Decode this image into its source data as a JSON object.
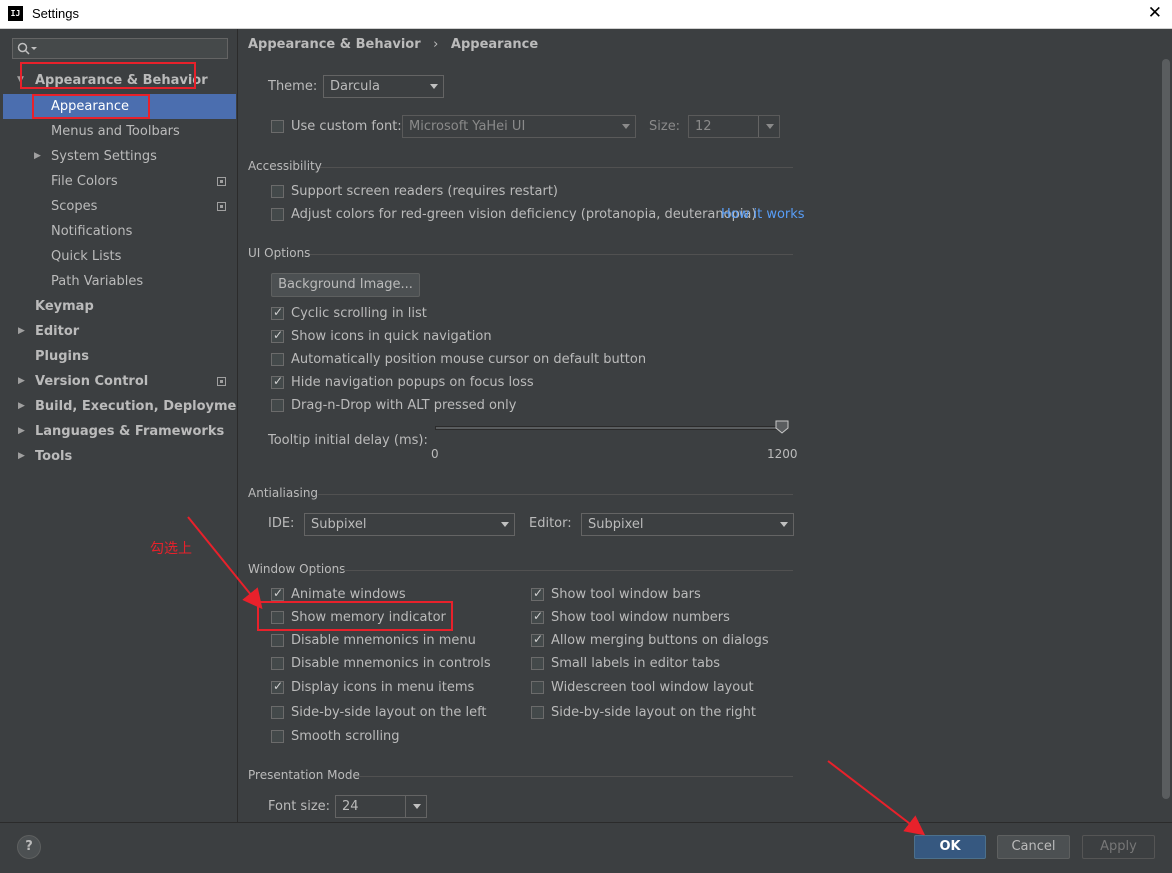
{
  "window": {
    "title": "Settings",
    "app_icon": "IJ",
    "close": "✕"
  },
  "sidebar": {
    "search": {
      "placeholder": ""
    },
    "items": [
      {
        "label": "Appearance & Behavior",
        "arrow": "▼"
      },
      {
        "label": "Appearance"
      },
      {
        "label": "Menus and Toolbars"
      },
      {
        "label": "System Settings",
        "arrow": "▶"
      },
      {
        "label": "File Colors"
      },
      {
        "label": "Scopes"
      },
      {
        "label": "Notifications"
      },
      {
        "label": "Quick Lists"
      },
      {
        "label": "Path Variables"
      },
      {
        "label": "Keymap"
      },
      {
        "label": "Editor",
        "arrow": "▶"
      },
      {
        "label": "Plugins"
      },
      {
        "label": "Version Control",
        "arrow": "▶"
      },
      {
        "label": "Build, Execution, Deployment",
        "arrow": "▶"
      },
      {
        "label": "Languages & Frameworks",
        "arrow": "▶"
      },
      {
        "label": "Tools",
        "arrow": "▶"
      }
    ]
  },
  "breadcrumb": {
    "parent": "Appearance & Behavior",
    "separator": "›",
    "current": "Appearance"
  },
  "theme": {
    "label": "Theme:",
    "value": "Darcula"
  },
  "custom_font": {
    "label": "Use custom font:",
    "checked": false,
    "font": "Microsoft YaHei UI",
    "size_label": "Size:",
    "size": "12"
  },
  "accessibility": {
    "title": "Accessibility",
    "screen_readers": "Support screen readers (requires restart)",
    "color_deficiency": "Adjust colors for red-green vision deficiency (protanopia, deuteranopia)",
    "how_it_works": "How it works"
  },
  "ui_options": {
    "title": "UI Options",
    "background_image": "Background Image...",
    "cyclic_scrolling": "Cyclic scrolling in list",
    "show_icons_quick_nav": "Show icons in quick navigation",
    "auto_position_mouse": "Automatically position mouse cursor on default button",
    "hide_nav_popups": "Hide navigation popups on focus loss",
    "drag_n_drop_alt": "Drag-n-Drop with ALT pressed only",
    "tooltip_label": "Tooltip initial delay (ms):",
    "tooltip_min": "0",
    "tooltip_max": "1200",
    "tooltip_value": 1200
  },
  "antialiasing": {
    "title": "Antialiasing",
    "ide_label": "IDE:",
    "ide_value": "Subpixel",
    "editor_label": "Editor:",
    "editor_value": "Subpixel"
  },
  "window_options": {
    "title": "Window Options",
    "animate_windows": "Animate windows",
    "show_memory_indicator": "Show memory indicator",
    "disable_mnemonics_menu": "Disable mnemonics in menu",
    "disable_mnemonics_controls": "Disable mnemonics in controls",
    "display_icons_menu": "Display icons in menu items",
    "side_by_side_left": "Side-by-side layout on the left",
    "smooth_scrolling": "Smooth scrolling",
    "show_tool_window_bars": "Show tool window bars",
    "show_tool_window_numbers": "Show tool window numbers",
    "allow_merging_buttons": "Allow merging buttons on dialogs",
    "small_labels_editor_tabs": "Small labels in editor tabs",
    "widescreen_layout": "Widescreen tool window layout",
    "side_by_side_right": "Side-by-side layout on the right"
  },
  "presentation_mode": {
    "title": "Presentation Mode",
    "font_size_label": "Font size:",
    "font_size": "24"
  },
  "footer": {
    "help": "?",
    "ok": "OK",
    "cancel": "Cancel",
    "apply": "Apply"
  },
  "annotation": {
    "text": "勾选上",
    "color": "#e8212b"
  },
  "colors": {
    "selection": "#4b6eaf",
    "background": "#3c3f41",
    "link": "#589df6",
    "ok_button": "#365880"
  }
}
